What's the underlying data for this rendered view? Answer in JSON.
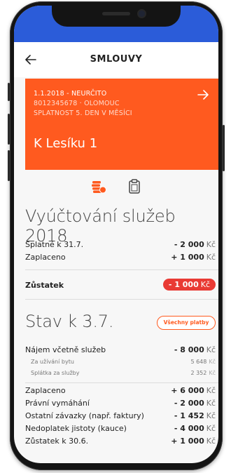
{
  "header": {
    "back_icon": "arrow-left-icon",
    "title": "SMLOUVY"
  },
  "contract": {
    "line1": "1.1.2018 - NEURČITO",
    "line2": "8012345678 · OLOMOUC",
    "line3": "SPLATNOST 5. DEN V MĚSÍCI",
    "address": "K Lesíku 1",
    "open_icon": "arrow-right-icon",
    "color": "#ff5a1f"
  },
  "tabs": {
    "coins_icon": "coins-icon",
    "clipboard_icon": "clipboard-icon"
  },
  "billing": {
    "title": "Vyúčtování služeb 2018",
    "rows": [
      {
        "label": "Splatné k 31.7.",
        "value": "- 2 000",
        "unit": "Kč"
      },
      {
        "label": "Zaplaceno",
        "value": "+ 1 000",
        "unit": "Kč"
      }
    ],
    "balance": {
      "label": "Zůstatek",
      "value": "- 1 000",
      "unit": "Kč",
      "color": "#e93a34"
    }
  },
  "status": {
    "title": "Stav k 3.7.",
    "all_payments": "Všechny platby",
    "rent": {
      "label": "Nájem včetně služeb",
      "value": "- 8 000",
      "unit": "Kč"
    },
    "rent_details": [
      {
        "label": "Za užívání bytu",
        "value": "5 648",
        "unit": "Kč"
      },
      {
        "label": "Splátka za služby",
        "value": "2 352",
        "unit": "Kč"
      }
    ],
    "rows": [
      {
        "label": "Zaplaceno",
        "value": "+ 6 000",
        "unit": "Kč"
      },
      {
        "label": "Právní vymáhání",
        "value": "- 2 000",
        "unit": "Kč"
      },
      {
        "label": "Ostatní závazky (např. faktury)",
        "value": "- 1 452",
        "unit": "Kč"
      },
      {
        "label": "Nedoplatek jistoty (kauce)",
        "value": "- 4 000",
        "unit": "Kč"
      },
      {
        "label": "Zůstatek k 30.6.",
        "value": "+ 1 000",
        "unit": "Kč"
      }
    ]
  }
}
